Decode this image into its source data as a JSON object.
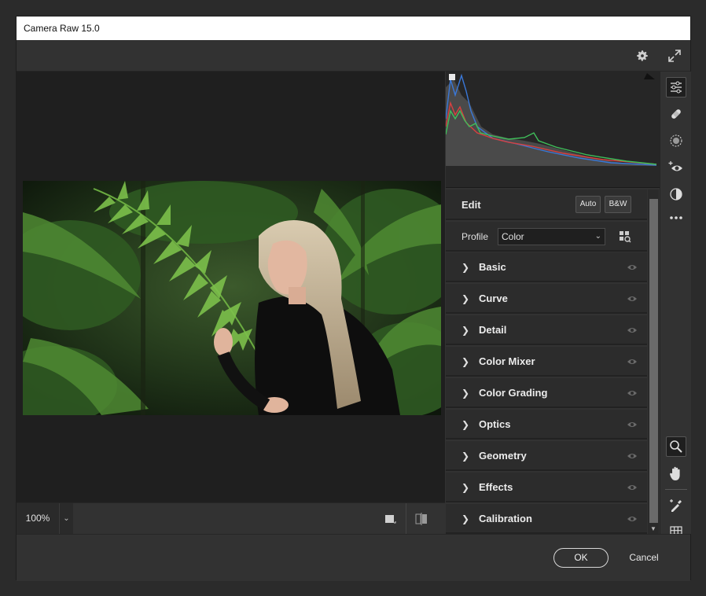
{
  "window": {
    "title": "Camera Raw 15.0"
  },
  "topbar": {
    "settings_icon": "gear-icon",
    "fullscreen_icon": "expand-icon"
  },
  "preview": {
    "zoom": "100%"
  },
  "edit": {
    "title": "Edit",
    "auto_label": "Auto",
    "bw_label": "B&W",
    "profile_label": "Profile",
    "profile_value": "Color"
  },
  "sections": [
    {
      "label": "Basic"
    },
    {
      "label": "Curve"
    },
    {
      "label": "Detail"
    },
    {
      "label": "Color Mixer"
    },
    {
      "label": "Color Grading"
    },
    {
      "label": "Optics"
    },
    {
      "label": "Geometry"
    },
    {
      "label": "Effects"
    },
    {
      "label": "Calibration"
    }
  ],
  "tools": [
    "edit-sliders-icon",
    "healing-bandage-icon",
    "masking-icon",
    "red-eye-icon",
    "presets-icon",
    "more-icon",
    "zoom-icon",
    "hand-icon",
    "color-sampler-icon",
    "grid-overlay-icon"
  ],
  "footer": {
    "ok_label": "OK",
    "cancel_label": "Cancel"
  },
  "colors": {
    "background": "#323232",
    "panel": "#2c2c2c",
    "accent": "#ffffff"
  }
}
